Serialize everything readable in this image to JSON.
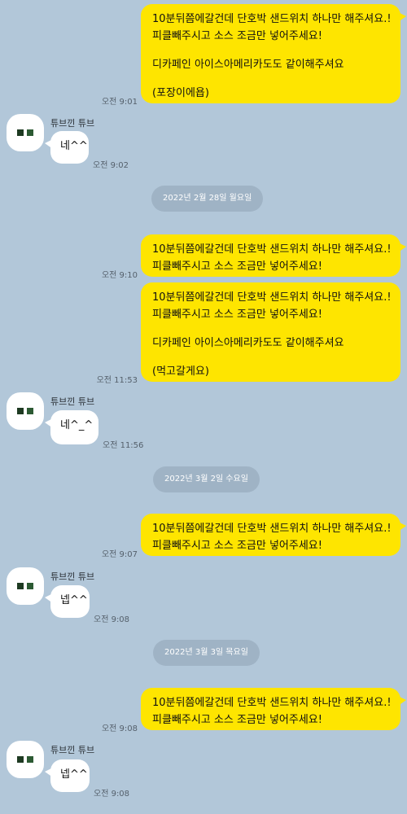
{
  "colors": {
    "background": "#b2c7d9",
    "outgoing_bubble": "#fee500",
    "incoming_bubble": "#ffffff",
    "date_pill": "#9fb3c5"
  },
  "sender_name": "튜브낀 튜브",
  "avatar_icon": "profile-avatar-icon",
  "messages": {
    "m1": {
      "lines": [
        "10분뒤쯤에갈건데 단호박 샌드위치 하나만 해주셔요.!",
        "피클빼주시고 소스 조금만 넣어주세요!"
      ],
      "lines2": [
        "디카페인 아이스아메리카도도 같이해주셔요"
      ],
      "lines3": [
        "(포장이에욥)"
      ],
      "time": "오전 9:01"
    },
    "r1": {
      "text": "네^^",
      "time": "오전 9:02"
    },
    "date1": "2022년 2월 28일 월요일",
    "m2": {
      "lines": [
        "10분뒤쯤에갈건데 단호박 샌드위치 하나만 해주셔요.!",
        "피클빼주시고 소스 조금만 넣어주세요!"
      ],
      "time": "오전 9:10"
    },
    "m3": {
      "lines": [
        "10분뒤쯤에갈건데 단호박 샌드위치 하나만 해주셔요.!",
        "피클빼주시고 소스 조금만 넣어주세요!"
      ],
      "lines2": [
        "디카페인 아이스아메리카도도 같이해주셔요"
      ],
      "lines3": [
        "(먹고갈게요)"
      ],
      "time": "오전 11:53"
    },
    "r2": {
      "text": "네^_^",
      "time": "오전 11:56"
    },
    "date2": "2022년 3월 2일 수요일",
    "m4": {
      "lines": [
        "10분뒤쯤에갈건데 단호박 샌드위치 하나만 해주셔요.!",
        "피클빼주시고 소스 조금만 넣어주세요!"
      ],
      "time": "오전 9:07"
    },
    "r3": {
      "text": "넵^^",
      "time": "오전 9:08"
    },
    "date3": "2022년 3월 3일 목요일",
    "m5": {
      "lines": [
        "10분뒤쯤에갈건데 단호박 샌드위치 하나만 해주셔요.!",
        "피클빼주시고 소스 조금만 넣어주세요!"
      ],
      "time": "오전 9:08"
    },
    "r4": {
      "text": "넵^^",
      "time": "오전 9:08"
    }
  }
}
